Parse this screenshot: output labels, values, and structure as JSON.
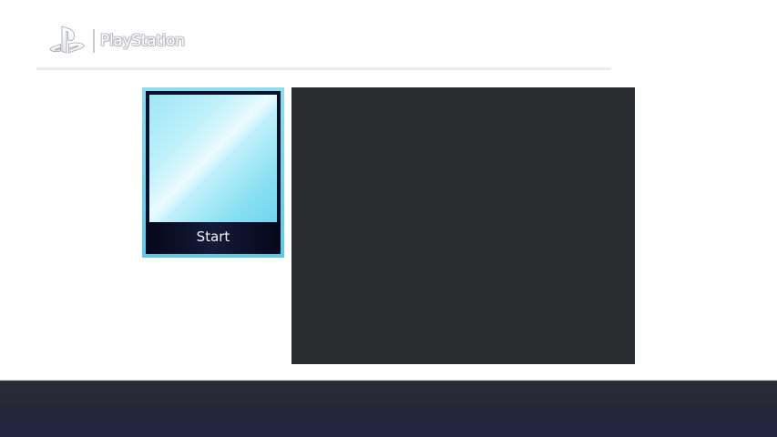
{
  "header": {
    "logo_text": "PlayStation"
  },
  "tiles": [
    {
      "label": "Start",
      "selected": true
    }
  ],
  "colors": {
    "tile_highlight": "#5ccae6",
    "preview_panel": "#292b2e",
    "bottom_bar": "#212540"
  },
  "icons": {
    "logo": "playstation-logo-icon"
  }
}
